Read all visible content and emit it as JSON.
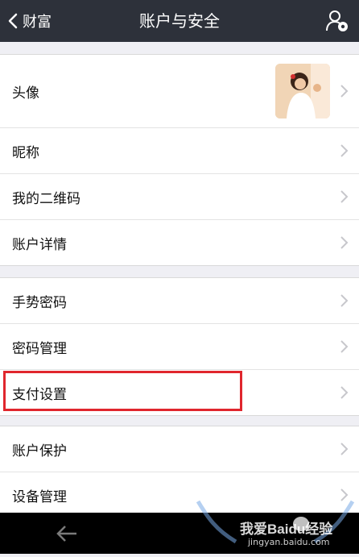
{
  "nav": {
    "back_label": "财富",
    "title": "账户与安全",
    "user_icon": "user-settings-icon"
  },
  "section1": {
    "items": [
      {
        "label": "头像"
      },
      {
        "label": "昵称"
      },
      {
        "label": "我的二维码"
      },
      {
        "label": "账户详情"
      }
    ]
  },
  "section2": {
    "items": [
      {
        "label": "手势密码"
      },
      {
        "label": "密码管理"
      },
      {
        "label": "支付设置"
      }
    ]
  },
  "section3": {
    "items": [
      {
        "label": "账户保护"
      },
      {
        "label": "设备管理"
      }
    ]
  },
  "watermark": {
    "text": "我爱Baidu经验",
    "sub": "jingyan.baidu.com"
  },
  "colors": {
    "navbar": "#2d313a",
    "background": "#efeff4",
    "highlight": "#e0262d"
  }
}
